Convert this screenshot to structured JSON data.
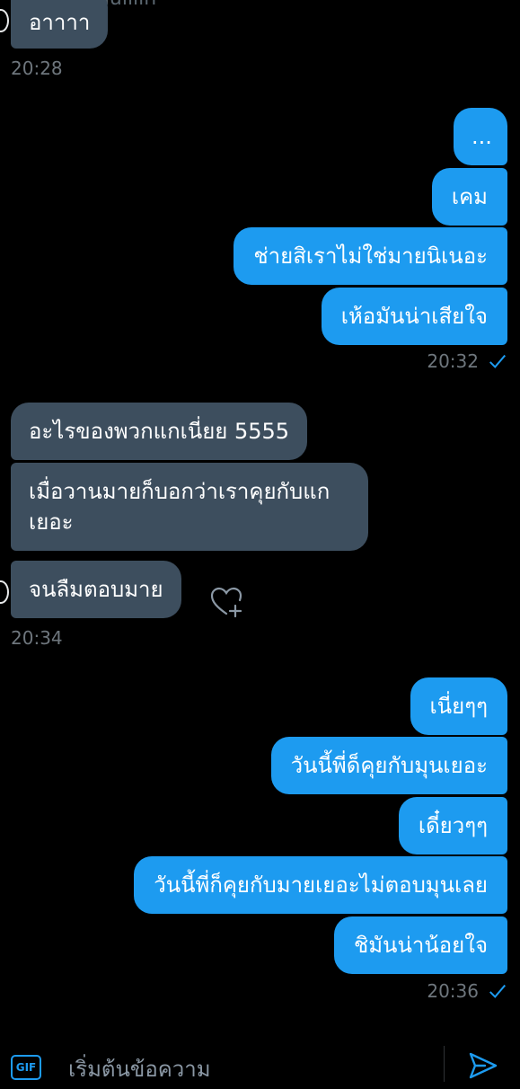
{
  "conversation": {
    "handle_partial": "@nuuiiiin"
  },
  "messages": {
    "g1": {
      "m1": "อาาาา"
    },
    "t1": "20:28",
    "g2": {
      "m1": "...",
      "m2": "เคม",
      "m3": "ช่ายสิเราไม่ใช่มายนิเนอะ",
      "m4": "เห้อมันน่าเสียใจ"
    },
    "t2": "20:32",
    "g3": {
      "m1": "อะไรของพวกแกเนี่ยย 5555",
      "m2": "เมื่อวานมายก็บอกว่าเราคุยกับแกเยอะ",
      "m3": "จนลืมตอบมาย"
    },
    "t3": "20:34",
    "g4": {
      "m1": "เนี่ยๆๆ",
      "m2": "วันนี้พี่ด็คุยกับมุนเยอะ",
      "m3": "เดี๋ยวๆๆ",
      "m4": "วันนี้พี่ก็คุยกับมายเยอะไม่ตอบมุนเลย",
      "m5": "ชิมันน่าน้อยใจ"
    },
    "t4": "20:36"
  },
  "composer": {
    "gif_label": "GIF",
    "placeholder": "เริ่มต้นข้อความ"
  },
  "colors": {
    "background": "#000000",
    "incoming_bubble": "#3d4e5e",
    "outgoing_bubble": "#1d9bf0",
    "timestamp": "#6e767d",
    "accent": "#1d9bf0"
  },
  "icons": {
    "read_receipt": "check-icon",
    "react": "heart-plus-icon",
    "send": "send-icon",
    "gif": "gif-icon"
  }
}
